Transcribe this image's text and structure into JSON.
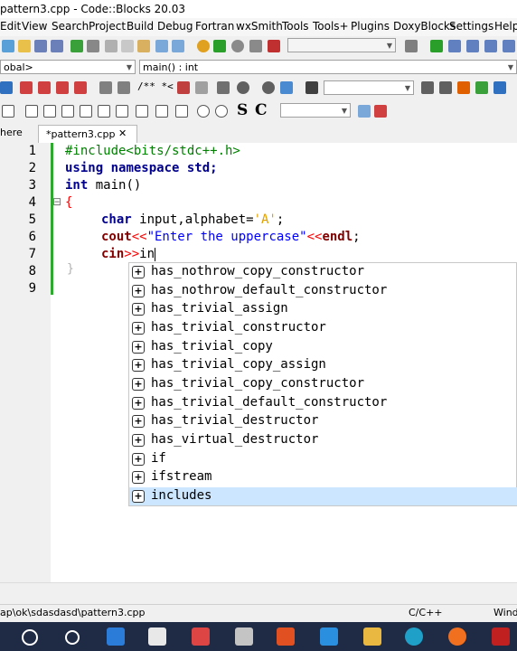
{
  "window": {
    "title": "pattern3.cpp - Code::Blocks 20.03"
  },
  "menu": [
    "Edit",
    "View",
    "Search",
    "Project",
    "Build",
    "Debug",
    "Fortran",
    "wxSmith",
    "Tools",
    "Tools+",
    "Plugins",
    "DoxyBlocks",
    "Settings",
    "Help"
  ],
  "toolbar2": {
    "scope_combo": "obal>",
    "function_combo": "main() : int"
  },
  "toolbar3": {
    "comment_label": "/** *<"
  },
  "toolbar4": {
    "bold_letter": "S",
    "c_letter": "C"
  },
  "tabs": {
    "left_label": "here",
    "active_label": "*pattern3.cpp",
    "close_glyph": "✕"
  },
  "editor": {
    "line_numbers": [
      "1",
      "2",
      "3",
      "4",
      "5",
      "6",
      "7",
      "8",
      "9"
    ],
    "fold_open": "⊟",
    "fold_end": "}",
    "lines": {
      "l1": "#include<bits/stdc++.h>",
      "l2_kw1": "using",
      "l2_kw2": "namespace",
      "l2_rest": " std;",
      "l3_kw": "int",
      "l3_rest": " main()",
      "l4": "{",
      "l5_kw": "char",
      "l5_rest": " input,alphabet=",
      "l5_chr": "'A'",
      "l5_end": ";",
      "l6_kw": "cout",
      "l6_op1": "<<",
      "l6_str": "\"Enter the uppercase\"",
      "l6_op2": "<<",
      "l6_kw2": "endl",
      "l6_end": ";",
      "l7_kw": "cin",
      "l7_op": ">>",
      "l7_rest": "in"
    }
  },
  "autocomplete": {
    "icon_glyph": "+",
    "items": [
      "has_nothrow_copy_constructor",
      "has_nothrow_default_constructor",
      "has_trivial_assign",
      "has_trivial_constructor",
      "has_trivial_copy",
      "has_trivial_copy_assign",
      "has_trivial_copy_constructor",
      "has_trivial_default_constructor",
      "has_trivial_destructor",
      "has_virtual_destructor",
      "if",
      "ifstream",
      "includes"
    ],
    "selected_index": 12
  },
  "status": {
    "path": "ap\\ok\\sdasdasd\\pattern3.cpp",
    "language": "C/C++",
    "right": "Wind"
  },
  "colors": {
    "selection": "#cce6ff",
    "change_bar": "#2ea82e",
    "taskbar": "#1f2a44"
  }
}
